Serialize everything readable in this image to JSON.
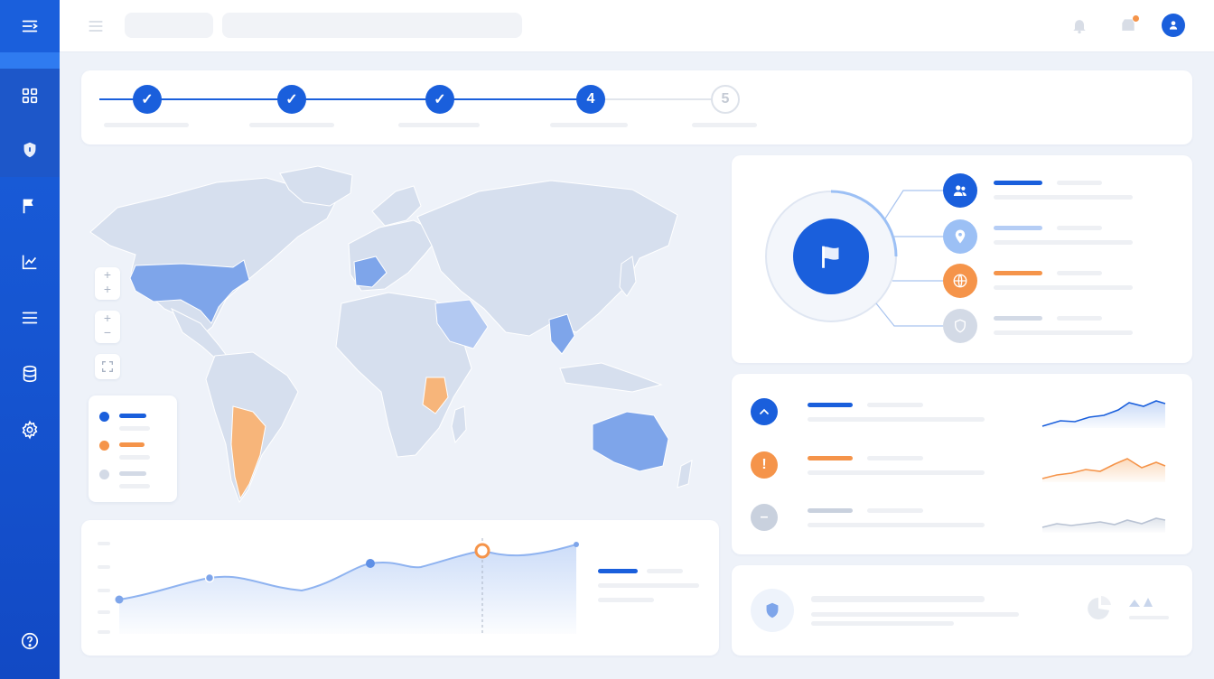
{
  "sidebar": {
    "items": [
      {
        "icon": "dashboard-grid-icon"
      },
      {
        "icon": "shield-icon",
        "active": true
      },
      {
        "icon": "flag-icon"
      },
      {
        "icon": "line-chart-icon"
      },
      {
        "icon": "list-icon"
      },
      {
        "icon": "database-icon"
      },
      {
        "icon": "gear-icon"
      },
      {
        "icon": "help-icon"
      }
    ]
  },
  "stepper": {
    "steps": [
      {
        "state": "done",
        "label": ""
      },
      {
        "state": "done",
        "label": ""
      },
      {
        "state": "done",
        "label": ""
      },
      {
        "state": "current",
        "label": "4"
      },
      {
        "state": "todo",
        "label": "5"
      }
    ]
  },
  "colors": {
    "primary": "#1a5fdc",
    "light_blue": "#8fb3f0",
    "orange": "#f5944a",
    "gray": "#c9d1de"
  },
  "map_legend": [
    {
      "color": "#1a5fdc"
    },
    {
      "color": "#f5944a"
    },
    {
      "color": "#c9d1de"
    }
  ],
  "hub": {
    "center_icon": "flag-icon",
    "nodes": [
      {
        "icon": "users-icon",
        "color": "#1a5fdc"
      },
      {
        "icon": "location-pin-icon",
        "color": "#9cc0f5"
      },
      {
        "icon": "globe-icon",
        "color": "#f5944a"
      },
      {
        "icon": "shield-icon",
        "color": "#d3dae6"
      }
    ]
  },
  "status_rows": [
    {
      "icon": "chevron-up-icon",
      "color": "#1a5fdc",
      "glyph": "⌃"
    },
    {
      "icon": "alert-icon",
      "color": "#f5944a",
      "glyph": "!"
    },
    {
      "icon": "minus-icon",
      "color": "#c9d1de",
      "glyph": "–"
    }
  ]
}
